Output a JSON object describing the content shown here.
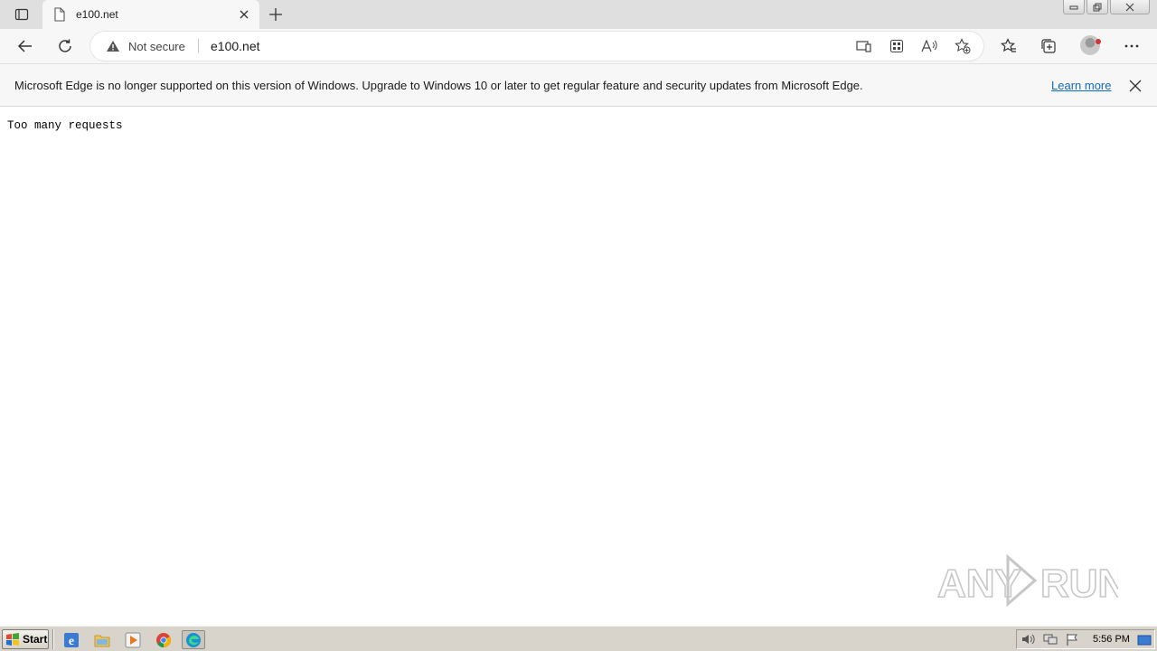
{
  "tab": {
    "title": "e100.net"
  },
  "toolbar": {
    "security_label": "Not secure",
    "url": "e100.net"
  },
  "infobar": {
    "message": "Microsoft Edge is no longer supported on this version of Windows. Upgrade to Windows 10 or later to get regular feature and security updates from Microsoft Edge.",
    "link": "Learn more"
  },
  "page": {
    "text": "Too many requests"
  },
  "watermark": {
    "text": "ANY RUN"
  },
  "taskbar": {
    "start_label": "Start",
    "clock": "5:56 PM"
  },
  "icons": {
    "tab_actions": "tab-actions-icon",
    "page": "page-icon",
    "close": "close-icon",
    "add": "plus-icon",
    "back": "back-arrow-icon",
    "refresh": "refresh-icon",
    "warning": "warning-icon",
    "favorites": "favorites-icon",
    "collections": "collections-icon",
    "more": "more-icon"
  },
  "colors": {
    "link": "#0f6cbd",
    "tabstrip": "#dfdfdf",
    "toolbar": "#f7f7f7",
    "taskbar": "#d8d4cb"
  }
}
